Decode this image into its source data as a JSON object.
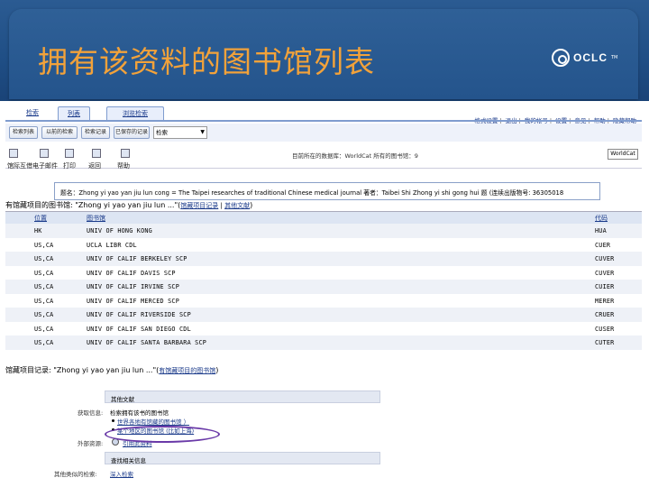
{
  "slide": {
    "title": "拥有该资料的图书馆列表",
    "logo_text": "OCLC",
    "logo_tm": "TM"
  },
  "topnav": {
    "tabs": [
      "检索",
      "列表",
      "浏览检索"
    ],
    "links": [
      "格式设置",
      "退出",
      "我的帐号",
      "设置",
      "意见",
      "帮助",
      "隐藏帮助"
    ]
  },
  "toolbar": {
    "buttons": [
      "检索列表",
      "以前的检索",
      "检索记录",
      "已保存的记录"
    ],
    "select_value": "检索",
    "select_arrow": "▼"
  },
  "actions": {
    "items": [
      "馆际互借",
      "电子邮件",
      "打印",
      "返回",
      "帮助"
    ],
    "status": "目前所在的数据库：WorldCat 所有的图书馆：9",
    "worldcat_logo": "WorldCat"
  },
  "record": {
    "info": "题名：Zhong yi yao yan jiu lun cong = The Taipei researches of traditional Chinese medical journal 著者：Taibei Shi Zhong yi shi gong hui 题 (连续出版物号: 36305018"
  },
  "holdings": {
    "heading": "有馆藏项目的图书馆: \"Zhong yi yao yan jiu lun ...\"(",
    "link1": "馆藏项目记录",
    "link_sep": " | ",
    "link2": "其他文献",
    "heading_end": ")",
    "columns": [
      "位置",
      "图书馆",
      "代码"
    ],
    "rows": [
      {
        "location": "HK",
        "library": "UNIV OF HONG KONG",
        "code": "HUA"
      },
      {
        "location": "US,CA",
        "library": "UCLA LIBR CDL",
        "code": "CUER"
      },
      {
        "location": "US,CA",
        "library": "UNIV OF CALIF BERKELEY SCP",
        "code": "CUVER"
      },
      {
        "location": "US,CA",
        "library": "UNIV OF CALIF DAVIS SCP",
        "code": "CUVER"
      },
      {
        "location": "US,CA",
        "library": "UNIV OF CALIF IRVINE SCP",
        "code": "CUIER"
      },
      {
        "location": "US,CA",
        "library": "UNIV OF CALIF MERCED SCP",
        "code": "MERER"
      },
      {
        "location": "US,CA",
        "library": "UNIV OF CALIF RIVERSIDE SCP",
        "code": "CRUER"
      },
      {
        "location": "US,CA",
        "library": "UNIV OF CALIF SAN DIEGO CDL",
        "code": "CUSER"
      },
      {
        "location": "US,CA",
        "library": "UNIV OF CALIF SANTA BARBARA SCP",
        "code": "CUTER"
      }
    ]
  },
  "location_record": {
    "heading": "馆藏项目记录: \"Zhong yi yao yan jiu lun ...\"(",
    "link": "有馆藏项目的图书馆",
    "heading_end": ")"
  },
  "panel": {
    "bar1": "其他文献",
    "label1": "获取信息:",
    "value1": "检索拥有该书的图书馆",
    "bullet1": "世界各地有馆藏的图书馆 ）",
    "bullet2": "某个地区的图书馆 (比如上海)",
    "label2": "外部资源:",
    "value2": "引用此资料",
    "bar2": "查找相关信息",
    "label3": "其他类似的检索:",
    "value3": "深入检索"
  }
}
